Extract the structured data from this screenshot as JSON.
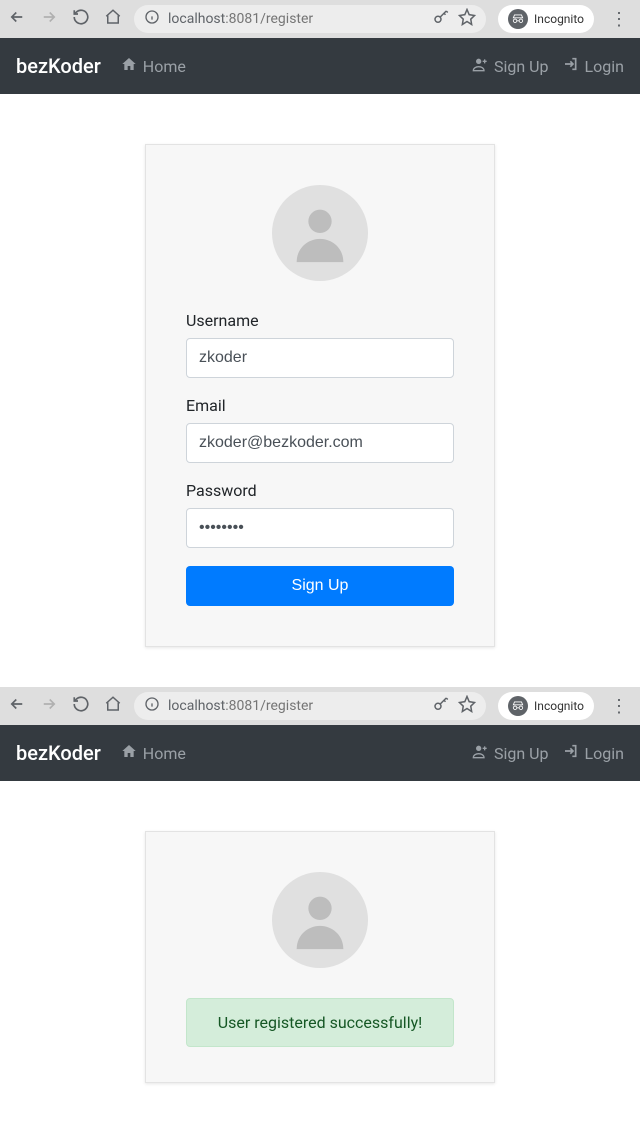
{
  "browser": {
    "url_host": "localhost",
    "url_portpath": ":8081/register",
    "incognito_label": "Incognito"
  },
  "nav": {
    "brand": "bezKoder",
    "home": "Home",
    "signup": "Sign Up",
    "login": "Login"
  },
  "form": {
    "username_label": "Username",
    "username_value": "zkoder",
    "email_label": "Email",
    "email_value": "zkoder@bezkoder.com",
    "password_label": "Password",
    "password_value": "••••••••",
    "submit_label": "Sign Up"
  },
  "success": {
    "message": "User registered successfully!"
  }
}
